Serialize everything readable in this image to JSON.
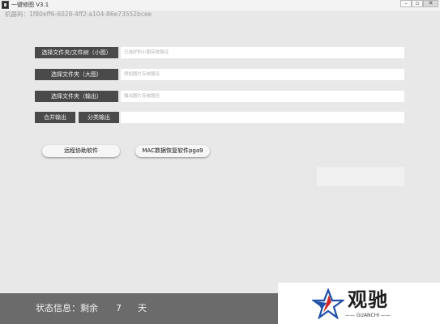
{
  "window": {
    "title": "一键修图 V3.1",
    "minimize_glyph": "–",
    "maximize_glyph": "▫",
    "close_glyph": "✕"
  },
  "machine_code": "机器码：1f80eff6-6028-4ff2-a104-86e73552bcee",
  "rows": [
    {
      "label": "选择文件夹/文件树（小图）",
      "placeholder": "已选好的小图存放路径"
    },
    {
      "label": "选择文件夹（大图）",
      "placeholder": "例如图片存放路径"
    },
    {
      "label": "选择文件夹（输出）",
      "placeholder": "输出图片存放路径"
    }
  ],
  "actions": {
    "merge_label": "合并输出",
    "classify_label": "分类输出",
    "output_value": ""
  },
  "buttons": {
    "remote_label": "远程协助软件",
    "mac_label": "MAC数据恢复软件pga9"
  },
  "status": {
    "label": "状态信息：剩余",
    "days": "7",
    "unit": "天"
  },
  "watermark": {
    "name": "观驰",
    "sub": "—— GUANCHI ——"
  },
  "colors": {
    "background": "#e8e8e8",
    "label_button": "#4a4a4a",
    "status_bar": "#6b6b6b",
    "watermark_red": "#d22a2a",
    "watermark_blue": "#1f4fa8"
  },
  "icons": {
    "app": "app-icon",
    "logo": "star-logo-icon"
  }
}
